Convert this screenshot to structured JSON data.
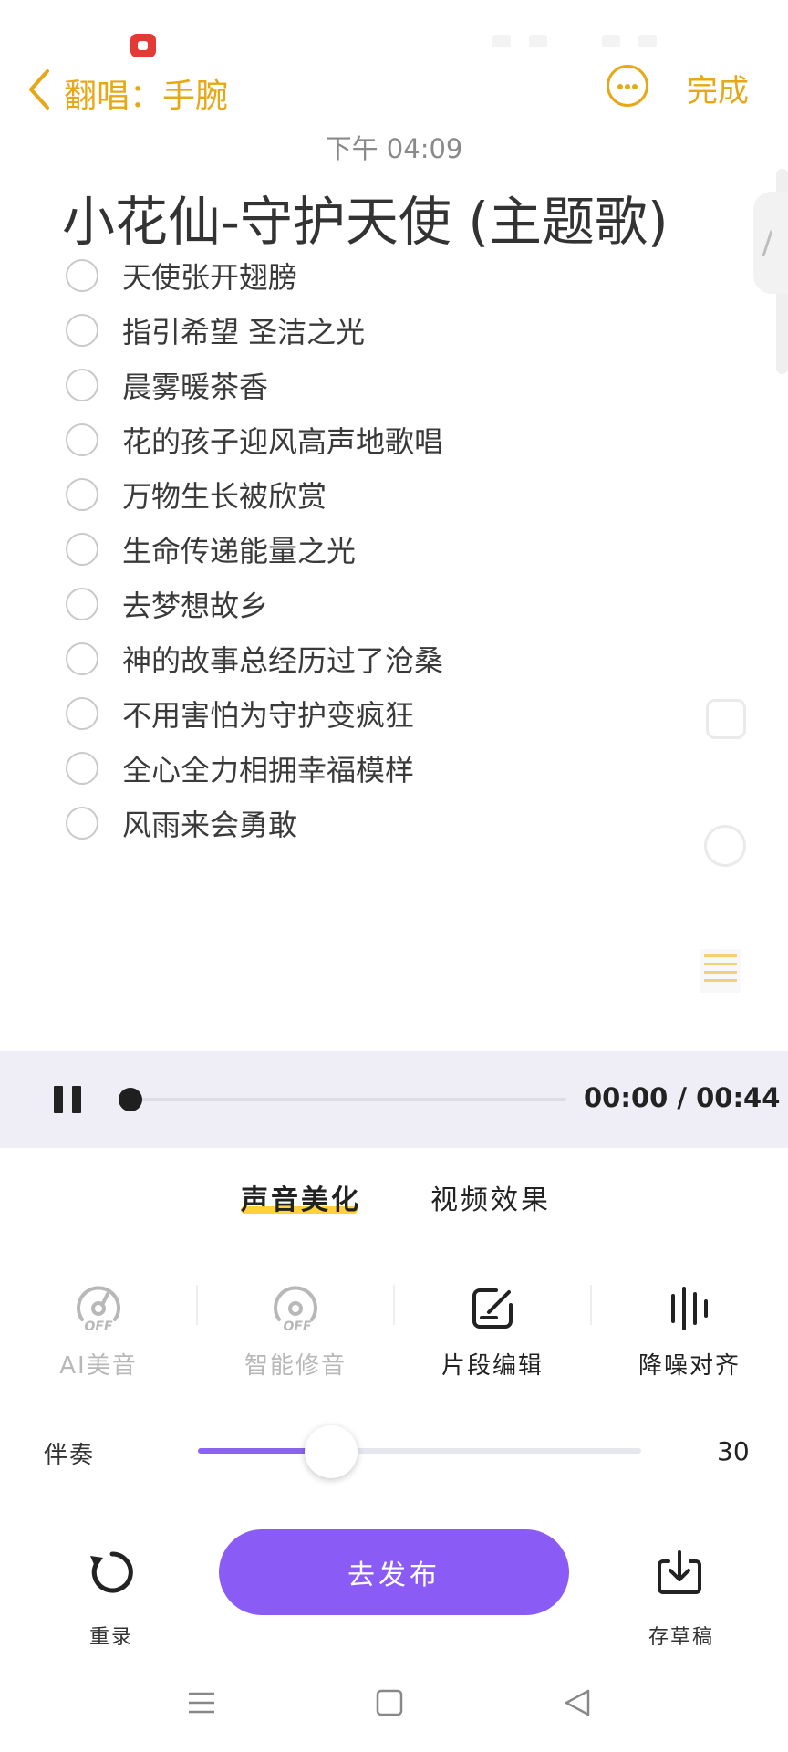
{
  "status_bar": {
    "recording_icon": "screen-record-icon"
  },
  "header": {
    "back_icon": "chevron-left-icon",
    "title": "翻唱：手腕",
    "more_icon": "more-circle-icon",
    "done_label": "完成",
    "accent_color": "#e6a817"
  },
  "note": {
    "time": "下午 04:09",
    "title": "小花仙-守护天使 (主题歌)",
    "items": [
      {
        "text": "天使张开翅膀",
        "checked": false
      },
      {
        "text": "指引希望 圣洁之光",
        "checked": false
      },
      {
        "text": "晨雾暖茶香",
        "checked": false
      },
      {
        "text": "花的孩子迎风高声地歌唱",
        "checked": false
      },
      {
        "text": "万物生长被欣赏",
        "checked": false
      },
      {
        "text": "生命传递能量之光",
        "checked": false
      },
      {
        "text": "去梦想故乡",
        "checked": false
      },
      {
        "text": "神的故事总经历过了沧桑",
        "checked": false
      },
      {
        "text": "不用害怕为守护变疯狂",
        "checked": false
      },
      {
        "text": "全心全力相拥幸福模样",
        "checked": false
      },
      {
        "text": "风雨来会勇敢",
        "checked": false
      }
    ]
  },
  "player": {
    "pause_icon": "pause-icon",
    "progress": 0.0,
    "time_text": "00:00 / 00:44"
  },
  "tabs": [
    {
      "label": "声音美化",
      "active": true
    },
    {
      "label": "视频效果",
      "active": false
    }
  ],
  "tools": [
    {
      "label": "AI美音",
      "icon": "ai-voice-off-icon",
      "enabled": false
    },
    {
      "label": "智能修音",
      "icon": "smart-tune-off-icon",
      "enabled": false
    },
    {
      "label": "片段编辑",
      "icon": "edit-segment-icon",
      "enabled": true
    },
    {
      "label": "降噪对齐",
      "icon": "noise-reduction-icon",
      "enabled": true
    }
  ],
  "accompaniment": {
    "label": "伴奏",
    "value": "30",
    "level": 0.3,
    "accent_color": "#8a5cf5"
  },
  "actions": {
    "rerecord_label": "重录",
    "rerecord_icon": "refresh-icon",
    "publish_label": "去发布",
    "draft_label": "存草稿",
    "draft_icon": "download-icon"
  },
  "nav": {
    "menu_icon": "menu-icon",
    "home_icon": "home-square-icon",
    "back_icon": "back-triangle-icon"
  }
}
